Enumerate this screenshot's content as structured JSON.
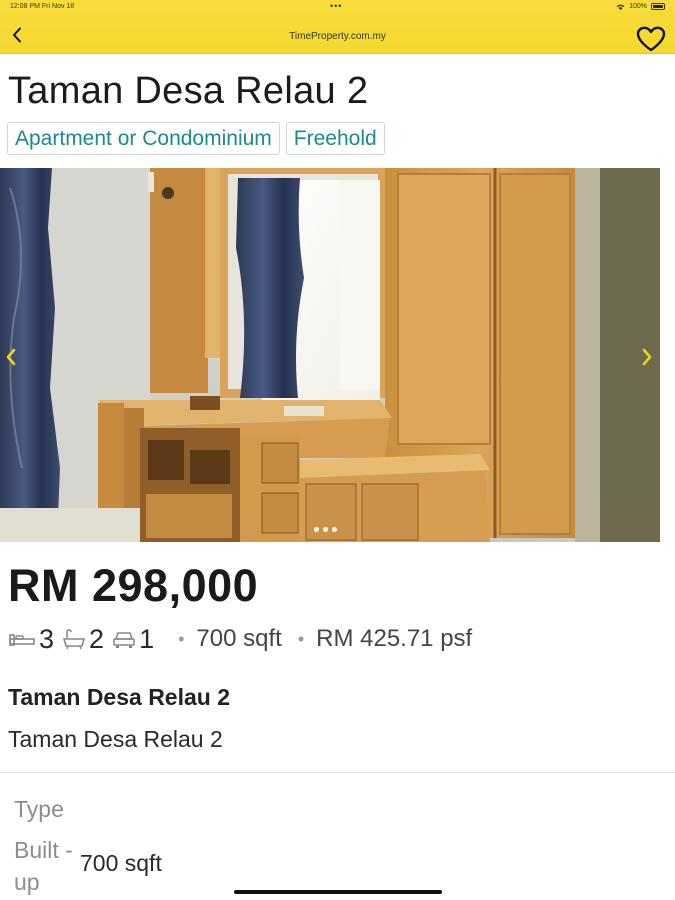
{
  "status": {
    "time": "12:08 PM  Fri Nov 18",
    "dots": "•••",
    "battery": "100%"
  },
  "header": {
    "url": "TimeProperty.com.my",
    "icons": {
      "back": "chevron-left-icon",
      "favorite": "heart-outline-icon"
    }
  },
  "listing": {
    "title": "Taman Desa Relau 2",
    "tags": [
      "Apartment or Condominium",
      "Freehold"
    ],
    "price": "RM 298,000",
    "bedrooms": "3",
    "bathrooms": "2",
    "parking": "1",
    "size": "700 sqft",
    "price_per_sqft": "RM 425.71 psf",
    "address_title": "Taman Desa Relau 2",
    "address_sub": "Taman Desa Relau 2"
  },
  "carousel": {
    "slides": 3,
    "active_slide": 1
  },
  "details": {
    "type_label": "Type",
    "built_label": "Built -up",
    "built_value": "700 sqft"
  },
  "colors": {
    "header_yellow": "#f7dc3c",
    "tag_text": "#1b8a8f",
    "arrow_yellow": "#f2d21c"
  }
}
